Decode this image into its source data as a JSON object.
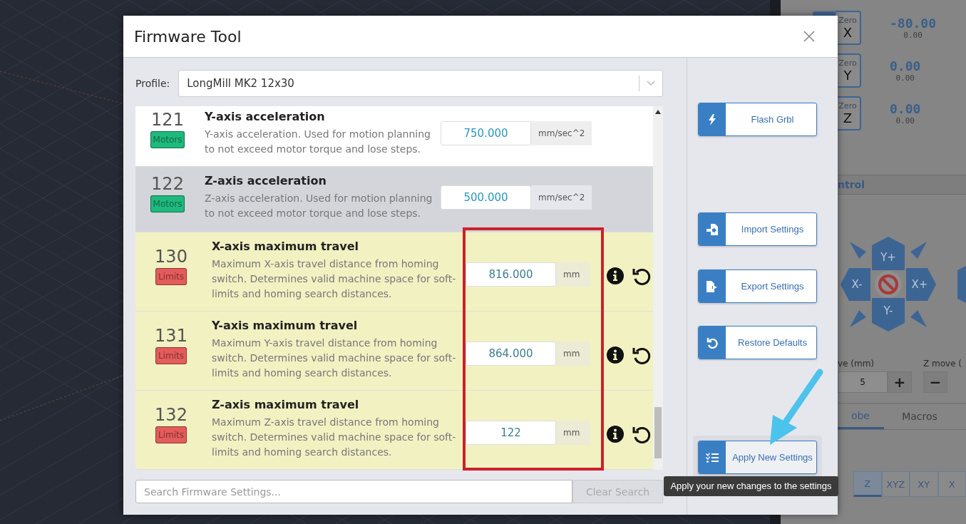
{
  "position": [
    {
      "zero_label": "Zero",
      "axis": "X",
      "value": "-80.00",
      "machine": "0.00"
    },
    {
      "zero_label": "Zero",
      "axis": "Y",
      "value": "0.00",
      "machine": "0.00"
    },
    {
      "zero_label": "Zero",
      "axis": "Z",
      "value": "0.00",
      "machine": "0.00"
    }
  ],
  "jog": {
    "title": "ntrol",
    "up": "Y+",
    "left": "X-",
    "right": "X+",
    "down": "Y-"
  },
  "move": [
    {
      "label": "ve (mm)",
      "value": "5",
      "button": "+"
    },
    {
      "label": "Z move (",
      "button": "−"
    }
  ],
  "tabs": [
    {
      "label": "obe",
      "selected": true
    },
    {
      "label": "Macros",
      "selected": false
    }
  ],
  "axis_buttons": [
    {
      "label": "Z",
      "selected": true
    },
    {
      "label": "XYZ",
      "selected": false
    },
    {
      "label": "XY",
      "selected": false
    },
    {
      "label": "X",
      "selected": false
    }
  ],
  "window": {
    "title": "Firmware Tool"
  },
  "profile": {
    "label": "Profile:",
    "value": "LongMill MK2 12x30"
  },
  "settings": [
    {
      "number": "121",
      "category": "Motors",
      "color": "#1fb97d",
      "title": "Y-axis acceleration",
      "description": "Y-axis acceleration. Used for motion planning to not exceed motor torque and lose steps.",
      "value": "750.000",
      "unit": "mm/sec^2",
      "hovered": false,
      "modified": false
    },
    {
      "number": "122",
      "category": "Motors",
      "color": "#1fb97d",
      "title": "Z-axis acceleration",
      "description": "Z-axis acceleration. Used for motion planning to not exceed motor torque and lose steps.",
      "value": "500.000",
      "unit": "mm/sec^2",
      "hovered": true,
      "modified": false
    },
    {
      "number": "130",
      "category": "Limits",
      "color": "#e45b5b",
      "title": "X-axis maximum travel",
      "description": "Maximum X-axis travel distance from homing switch. Determines valid machine space for soft-limits and homing search distances.",
      "value": "816.000",
      "unit": "mm",
      "hovered": false,
      "modified": true
    },
    {
      "number": "131",
      "category": "Limits",
      "color": "#e45b5b",
      "title": "Y-axis maximum travel",
      "description": "Maximum Y-axis travel distance from homing switch. Determines valid machine space for soft-limits and homing search distances.",
      "value": "864.000",
      "unit": "mm",
      "hovered": false,
      "modified": true
    },
    {
      "number": "132",
      "category": "Limits",
      "color": "#e45b5b",
      "title": "Z-axis maximum travel",
      "description": "Maximum Z-axis travel distance from homing switch. Determines valid machine space for soft-limits and homing search distances.",
      "value": "122",
      "unit": "mm",
      "hovered": false,
      "modified": true
    }
  ],
  "search": {
    "placeholder": "Search Firmware Settings...",
    "button": "Clear Search"
  },
  "actions": [
    {
      "label": "Flash Grbl",
      "kind": "flash",
      "selected": false
    },
    {
      "label": "Import Settings",
      "kind": "import",
      "selected": false
    },
    {
      "label": "Export Settings",
      "kind": "export",
      "selected": false
    },
    {
      "label": "Restore Defaults",
      "kind": "restore",
      "selected": false
    },
    {
      "label": "Apply New Settings",
      "kind": "apply",
      "selected": true
    }
  ],
  "tooltip": "Apply your new changes to the settings"
}
